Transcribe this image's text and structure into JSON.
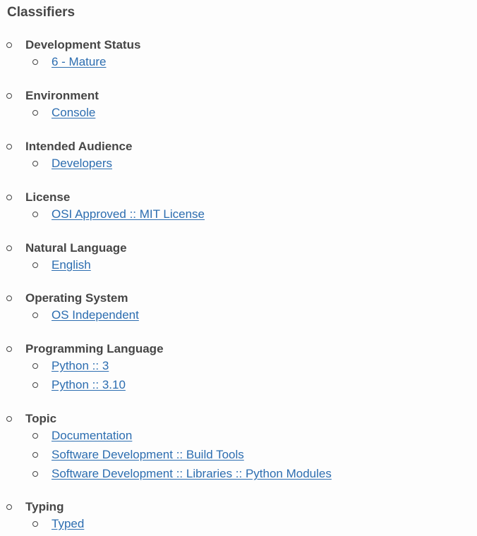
{
  "title": "Classifiers",
  "groups": [
    {
      "label": "Development Status",
      "items": [
        "6 - Mature"
      ]
    },
    {
      "label": "Environment",
      "items": [
        "Console"
      ]
    },
    {
      "label": "Intended Audience",
      "items": [
        "Developers"
      ]
    },
    {
      "label": "License",
      "items": [
        "OSI Approved :: MIT License"
      ]
    },
    {
      "label": "Natural Language",
      "items": [
        "English"
      ]
    },
    {
      "label": "Operating System",
      "items": [
        "OS Independent"
      ]
    },
    {
      "label": "Programming Language",
      "items": [
        "Python :: 3",
        "Python :: 3.10"
      ]
    },
    {
      "label": "Topic",
      "items": [
        "Documentation",
        "Software Development :: Build Tools",
        "Software Development :: Libraries :: Python Modules"
      ]
    },
    {
      "label": "Typing",
      "items": [
        "Typed"
      ]
    }
  ]
}
